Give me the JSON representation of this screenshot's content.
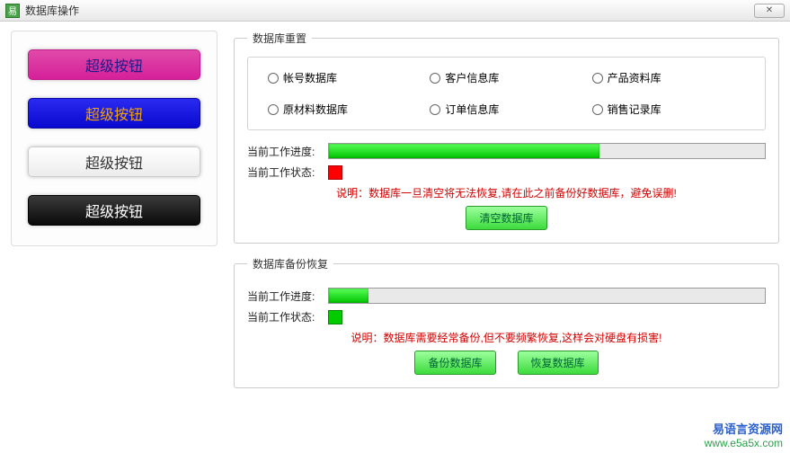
{
  "titlebar": {
    "title": "数据库操作",
    "close": "✕"
  },
  "side": {
    "buttons": [
      {
        "label": "超级按钮"
      },
      {
        "label": "超级按钮"
      },
      {
        "label": "超级按钮"
      },
      {
        "label": "超级按钮"
      }
    ]
  },
  "reset_group": {
    "legend": "数据库重置",
    "radios": [
      "帐号数据库",
      "客户信息库",
      "产品资料库",
      "原材料数据库",
      "订单信息库",
      "销售记录库"
    ],
    "progress_label": "当前工作进度:",
    "progress_pct": 62,
    "status_label": "当前工作状态:",
    "status_color": "red",
    "hint_prefix": "说明：",
    "hint": "数据库一旦清空将无法恢复,请在此之前备份好数据库，避免误删!",
    "action": "清空数据库"
  },
  "backup_group": {
    "legend": "数据库备份恢复",
    "progress_label": "当前工作进度:",
    "progress_pct": 9,
    "status_label": "当前工作状态:",
    "status_color": "green",
    "hint_prefix": "说明：",
    "hint": "数据库需要经常备份,但不要频繁恢复,这样会对硬盘有损害!",
    "action_backup": "备份数据库",
    "action_restore": "恢复数据库"
  },
  "watermark": {
    "line1": "易语言资源网",
    "line2": "www.e5a5x.com"
  }
}
